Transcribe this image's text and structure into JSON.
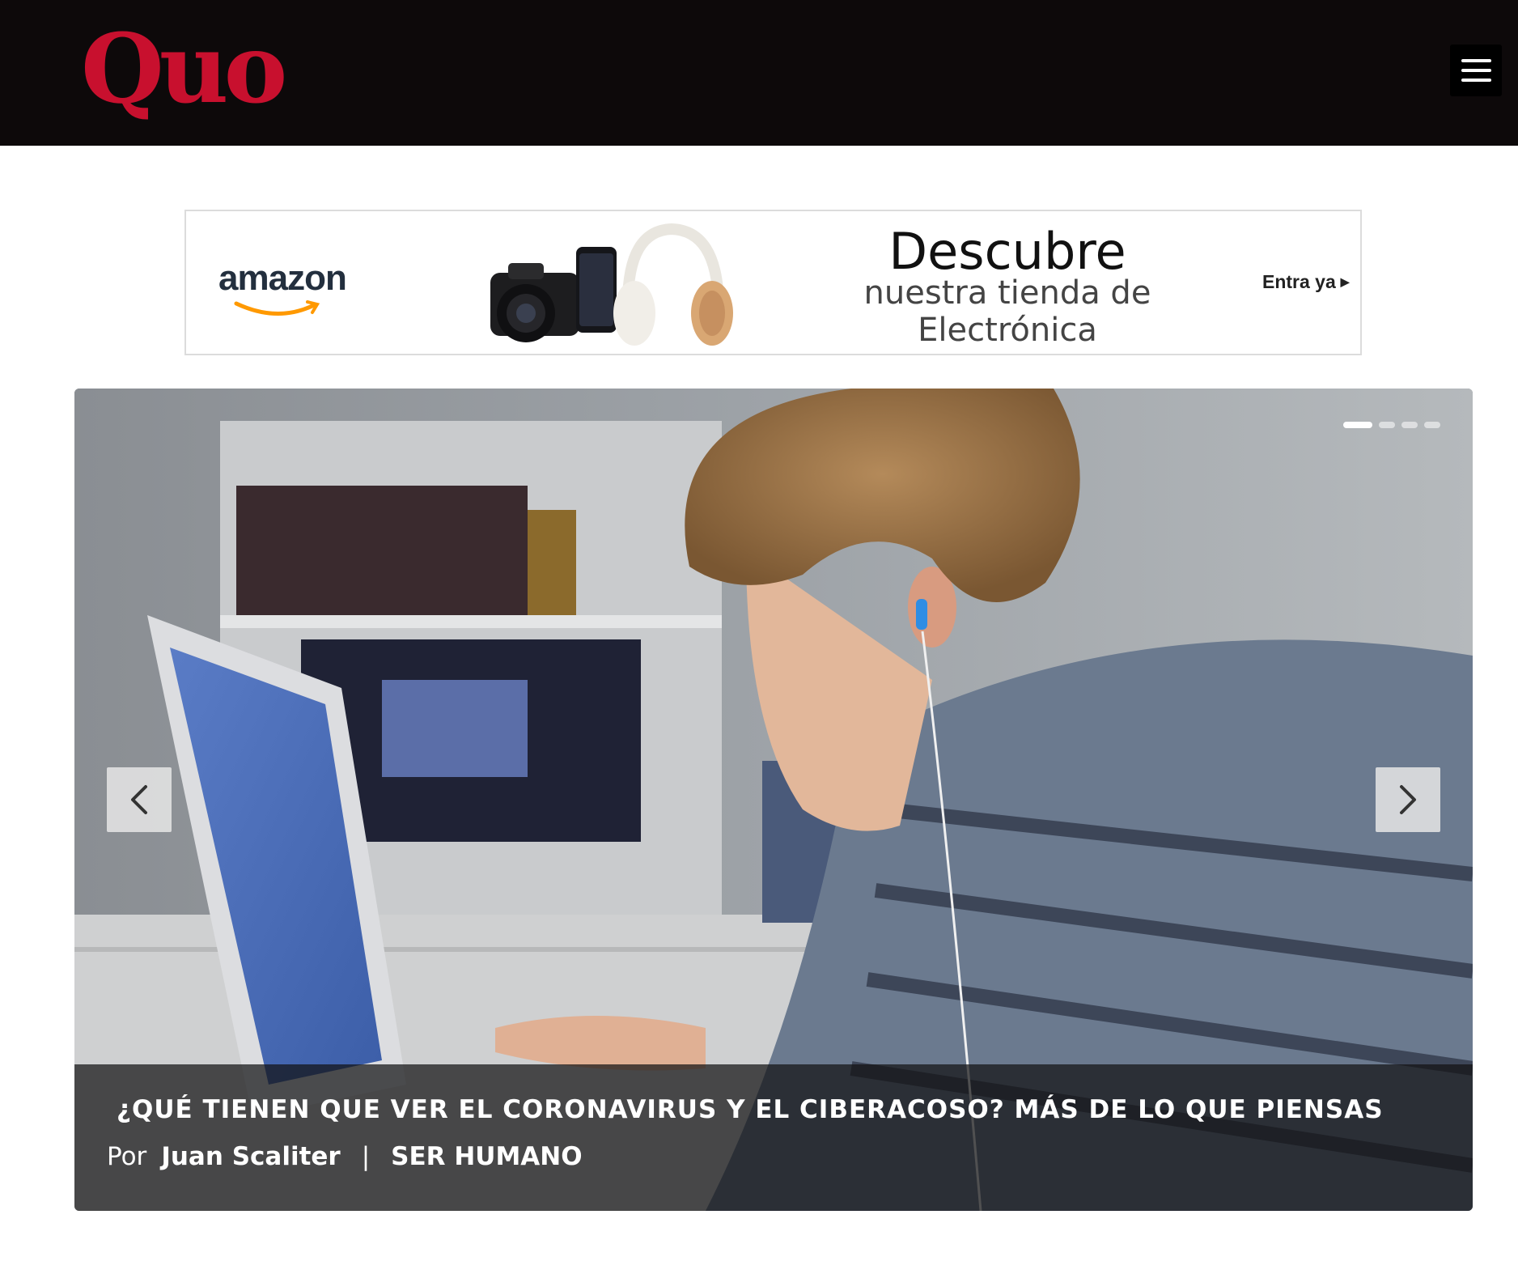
{
  "header": {
    "logo": "Quo",
    "menu_icon": "hamburger-menu-icon",
    "logo_color": "#c8102e",
    "background": "#0d090a"
  },
  "ad": {
    "brand": "amazon",
    "headline": "Descubre",
    "subline_1": "nuestra tienda de",
    "subline_2": "Electrónica",
    "cta": "Entra ya",
    "cta_icon": "caret-right-icon",
    "brand_accent": "#ff9900"
  },
  "slider": {
    "title": "¿QUÉ TIENEN QUE VER EL CORONAVIRUS Y EL CIBERACOSO? MÁS DE LO QUE PIENSAS",
    "by_label": "Por",
    "author": "Juan Scaliter",
    "separator": "|",
    "section": "SER HUMANO",
    "slide_count": 4,
    "active_slide": 1,
    "prev_icon": "chevron-left-icon",
    "next_icon": "chevron-right-icon"
  }
}
